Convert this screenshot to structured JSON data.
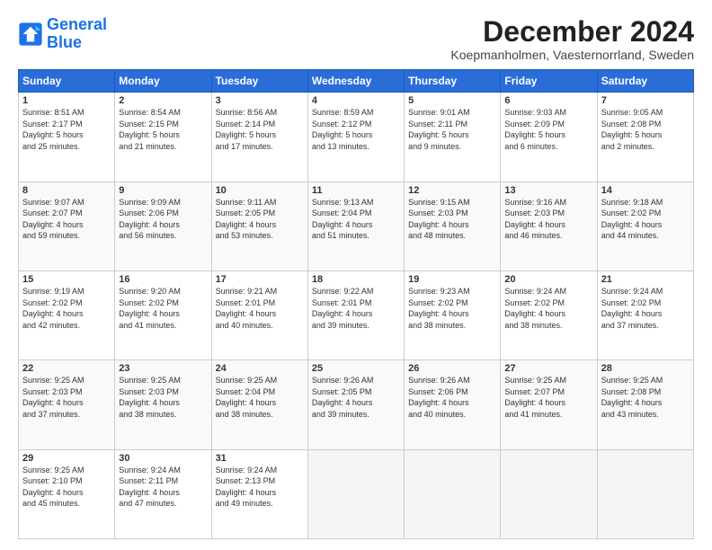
{
  "logo": {
    "line1": "General",
    "line2": "Blue"
  },
  "title": "December 2024",
  "location": "Koepmanholmen, Vaesternorrland, Sweden",
  "headers": [
    "Sunday",
    "Monday",
    "Tuesday",
    "Wednesday",
    "Thursday",
    "Friday",
    "Saturday"
  ],
  "weeks": [
    [
      {
        "day": 1,
        "info": "Sunrise: 8:51 AM\nSunset: 2:17 PM\nDaylight: 5 hours\nand 25 minutes."
      },
      {
        "day": 2,
        "info": "Sunrise: 8:54 AM\nSunset: 2:15 PM\nDaylight: 5 hours\nand 21 minutes."
      },
      {
        "day": 3,
        "info": "Sunrise: 8:56 AM\nSunset: 2:14 PM\nDaylight: 5 hours\nand 17 minutes."
      },
      {
        "day": 4,
        "info": "Sunrise: 8:59 AM\nSunset: 2:12 PM\nDaylight: 5 hours\nand 13 minutes."
      },
      {
        "day": 5,
        "info": "Sunrise: 9:01 AM\nSunset: 2:11 PM\nDaylight: 5 hours\nand 9 minutes."
      },
      {
        "day": 6,
        "info": "Sunrise: 9:03 AM\nSunset: 2:09 PM\nDaylight: 5 hours\nand 6 minutes."
      },
      {
        "day": 7,
        "info": "Sunrise: 9:05 AM\nSunset: 2:08 PM\nDaylight: 5 hours\nand 2 minutes."
      }
    ],
    [
      {
        "day": 8,
        "info": "Sunrise: 9:07 AM\nSunset: 2:07 PM\nDaylight: 4 hours\nand 59 minutes."
      },
      {
        "day": 9,
        "info": "Sunrise: 9:09 AM\nSunset: 2:06 PM\nDaylight: 4 hours\nand 56 minutes."
      },
      {
        "day": 10,
        "info": "Sunrise: 9:11 AM\nSunset: 2:05 PM\nDaylight: 4 hours\nand 53 minutes."
      },
      {
        "day": 11,
        "info": "Sunrise: 9:13 AM\nSunset: 2:04 PM\nDaylight: 4 hours\nand 51 minutes."
      },
      {
        "day": 12,
        "info": "Sunrise: 9:15 AM\nSunset: 2:03 PM\nDaylight: 4 hours\nand 48 minutes."
      },
      {
        "day": 13,
        "info": "Sunrise: 9:16 AM\nSunset: 2:03 PM\nDaylight: 4 hours\nand 46 minutes."
      },
      {
        "day": 14,
        "info": "Sunrise: 9:18 AM\nSunset: 2:02 PM\nDaylight: 4 hours\nand 44 minutes."
      }
    ],
    [
      {
        "day": 15,
        "info": "Sunrise: 9:19 AM\nSunset: 2:02 PM\nDaylight: 4 hours\nand 42 minutes."
      },
      {
        "day": 16,
        "info": "Sunrise: 9:20 AM\nSunset: 2:02 PM\nDaylight: 4 hours\nand 41 minutes."
      },
      {
        "day": 17,
        "info": "Sunrise: 9:21 AM\nSunset: 2:01 PM\nDaylight: 4 hours\nand 40 minutes."
      },
      {
        "day": 18,
        "info": "Sunrise: 9:22 AM\nSunset: 2:01 PM\nDaylight: 4 hours\nand 39 minutes."
      },
      {
        "day": 19,
        "info": "Sunrise: 9:23 AM\nSunset: 2:02 PM\nDaylight: 4 hours\nand 38 minutes."
      },
      {
        "day": 20,
        "info": "Sunrise: 9:24 AM\nSunset: 2:02 PM\nDaylight: 4 hours\nand 38 minutes."
      },
      {
        "day": 21,
        "info": "Sunrise: 9:24 AM\nSunset: 2:02 PM\nDaylight: 4 hours\nand 37 minutes."
      }
    ],
    [
      {
        "day": 22,
        "info": "Sunrise: 9:25 AM\nSunset: 2:03 PM\nDaylight: 4 hours\nand 37 minutes."
      },
      {
        "day": 23,
        "info": "Sunrise: 9:25 AM\nSunset: 2:03 PM\nDaylight: 4 hours\nand 38 minutes."
      },
      {
        "day": 24,
        "info": "Sunrise: 9:25 AM\nSunset: 2:04 PM\nDaylight: 4 hours\nand 38 minutes."
      },
      {
        "day": 25,
        "info": "Sunrise: 9:26 AM\nSunset: 2:05 PM\nDaylight: 4 hours\nand 39 minutes."
      },
      {
        "day": 26,
        "info": "Sunrise: 9:26 AM\nSunset: 2:06 PM\nDaylight: 4 hours\nand 40 minutes."
      },
      {
        "day": 27,
        "info": "Sunrise: 9:25 AM\nSunset: 2:07 PM\nDaylight: 4 hours\nand 41 minutes."
      },
      {
        "day": 28,
        "info": "Sunrise: 9:25 AM\nSunset: 2:08 PM\nDaylight: 4 hours\nand 43 minutes."
      }
    ],
    [
      {
        "day": 29,
        "info": "Sunrise: 9:25 AM\nSunset: 2:10 PM\nDaylight: 4 hours\nand 45 minutes."
      },
      {
        "day": 30,
        "info": "Sunrise: 9:24 AM\nSunset: 2:11 PM\nDaylight: 4 hours\nand 47 minutes."
      },
      {
        "day": 31,
        "info": "Sunrise: 9:24 AM\nSunset: 2:13 PM\nDaylight: 4 hours\nand 49 minutes."
      },
      null,
      null,
      null,
      null
    ]
  ]
}
